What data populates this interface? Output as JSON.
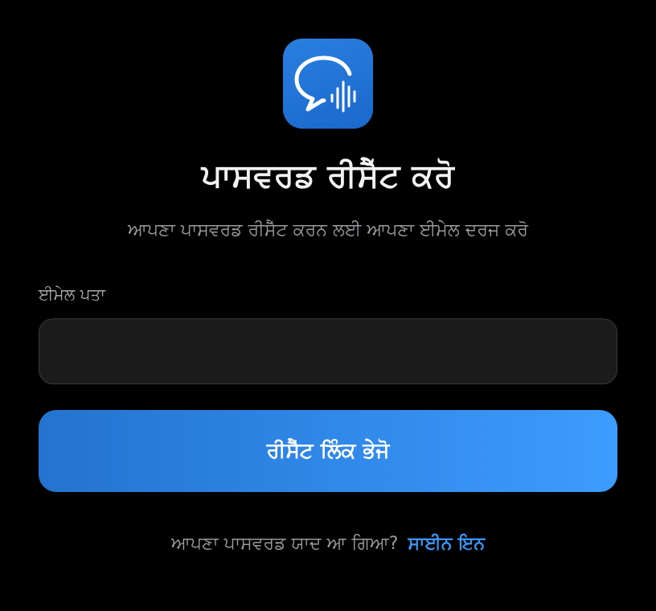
{
  "app": {
    "icon": "chat-bubble-soundwave-icon",
    "icon_color": "#1f6fd6"
  },
  "header": {
    "title": "ਪਾਸਵਰਡ ਰੀਸੈੱਟ ਕਰੋ",
    "subtitle": "ਆਪਣਾ ਪਾਸਵਰਡ ਰੀਸੈੱਟ ਕਰਨ ਲਈ ਆਪਣਾ ਈਮੇਲ ਦਰਜ ਕਰੋ"
  },
  "form": {
    "email_label": "ਈਮੇਲ ਪਤਾ",
    "email_value": "",
    "email_placeholder": "",
    "submit_label": "ਰੀਸੈੱਟ ਲਿੰਕ ਭੇਜੋ"
  },
  "footer": {
    "prompt": "ਆਪਣਾ ਪਾਸਵਰਡ ਯਾਦ ਆ ਗਿਆ?",
    "signin_label": "ਸਾਈਨ ਇਨ"
  },
  "colors": {
    "background": "#000000",
    "accent": "#3d97f5",
    "button_start": "#2373cf",
    "button_end": "#3d9cff"
  }
}
